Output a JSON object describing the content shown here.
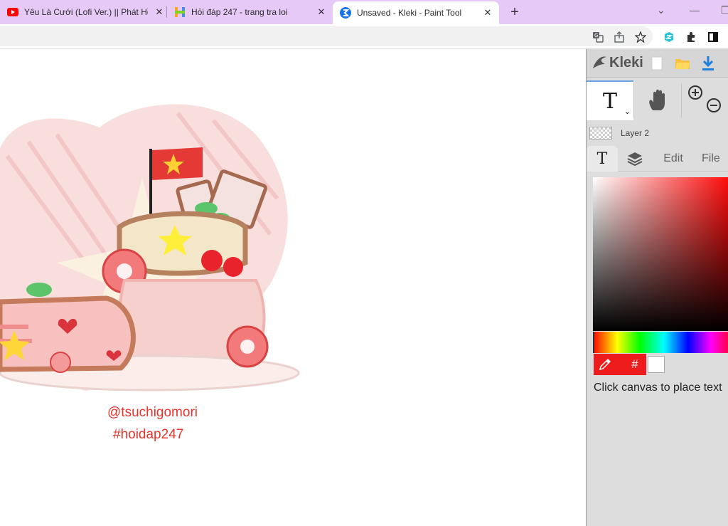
{
  "browser": {
    "tabs": [
      {
        "title": "Yêu Là Cưới (Lofi Ver.) || Phát Hồ",
        "close": "✕"
      },
      {
        "title": "Hỏi đáp 247 - trang tra loi",
        "close": "✕"
      },
      {
        "title": "Unsaved - Kleki - Paint Tool",
        "close": "✕"
      }
    ],
    "new_tab": "+",
    "window": {
      "dropdown": "⌄",
      "minimize": "—",
      "restore": "❐"
    }
  },
  "canvas": {
    "credit_line1": "@tsuchigomori",
    "credit_line2": "#hoidap247",
    "credit_color": "#e8332c"
  },
  "kleki": {
    "logo": "Kleki",
    "tool_text_glyph": "T",
    "tool_caret": "⌄",
    "layer_name": "Layer 2",
    "tabs": {
      "text_glyph": "T",
      "edit": "Edit",
      "file": "File"
    },
    "hex_button": "#",
    "hint": "Click canvas to place text",
    "primary_color": "#ee1c1c",
    "secondary_color": "#ffffff"
  }
}
